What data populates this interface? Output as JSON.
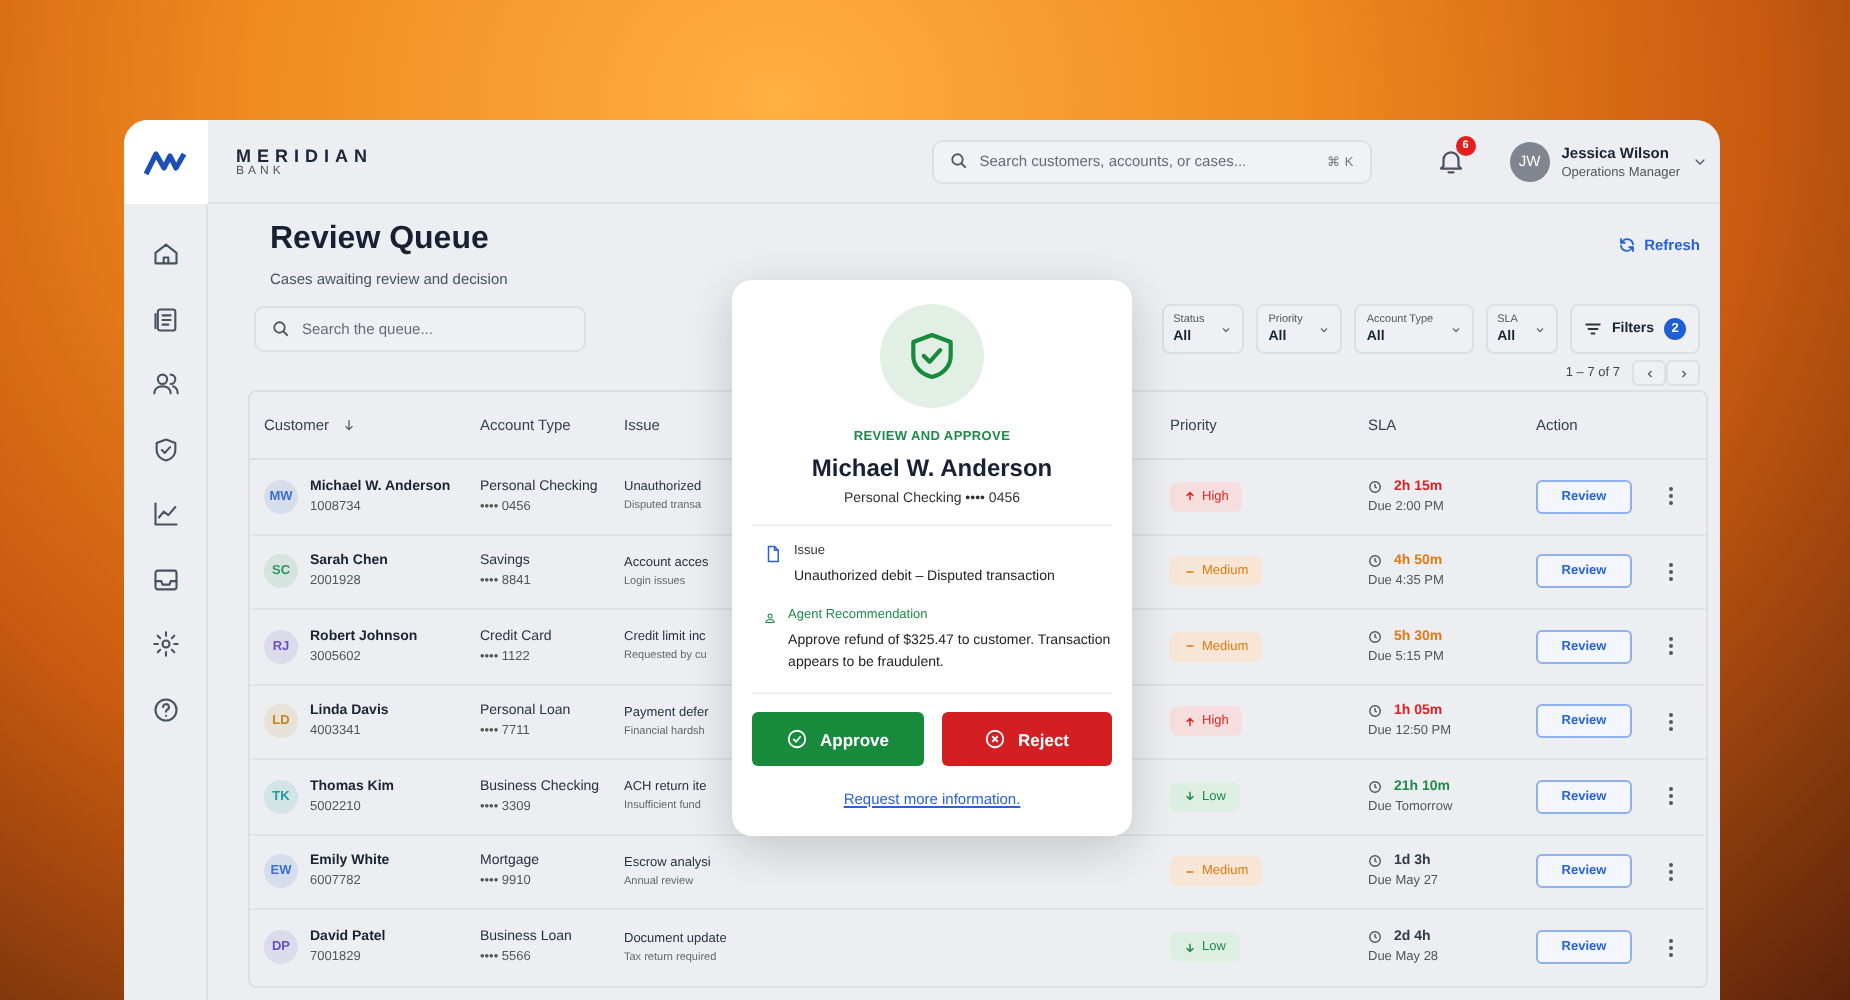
{
  "brand": {
    "name": "MERIDIAN",
    "sub": "BANK"
  },
  "search": {
    "placeholder": "Search customers, accounts, or cases...",
    "shortcut": "⌘ K"
  },
  "notifications": {
    "count": "6"
  },
  "user": {
    "initials": "JW",
    "name": "Jessica Wilson",
    "role": "Operations Manager"
  },
  "page": {
    "title": "Review Queue",
    "subtitle": "Cases awaiting review and decision",
    "refresh": "Refresh"
  },
  "queue_search": {
    "placeholder": "Search the queue..."
  },
  "filters": [
    {
      "label": "Status",
      "value": "All"
    },
    {
      "label": "Priority",
      "value": "All"
    },
    {
      "label": "Account Type",
      "value": "All"
    },
    {
      "label": "SLA",
      "value": "All"
    }
  ],
  "filters_button": {
    "label": "Filters",
    "count": "2"
  },
  "pagination": {
    "range": "1 – 7 of 7"
  },
  "table": {
    "columns": [
      {
        "label": "Customer",
        "sorted": true
      },
      {
        "label": "Account Type",
        "sorted": false
      },
      {
        "label": "Issue",
        "sorted": false
      },
      {
        "label": "Priority",
        "sorted": false
      },
      {
        "label": "SLA",
        "sorted": false
      },
      {
        "label": "Action",
        "sorted": false
      }
    ],
    "rows": [
      {
        "initials": "MW",
        "color": "#3b6fd8",
        "name": "Michael W. Anderson",
        "id": "1008734",
        "account": "Personal Checking",
        "account_number": "•••• 0456",
        "issue": "Unauthorized",
        "issue_detail": "Disputed transa",
        "priority": {
          "kind": "high",
          "label": "High"
        },
        "sla": {
          "kind": "critical",
          "time": "2h 15m",
          "due": "Due 2:00 PM"
        },
        "action": "Review"
      },
      {
        "initials": "SC",
        "color": "#2e9a5a",
        "name": "Sarah Chen",
        "id": "2001928",
        "account": "Savings",
        "account_number": "•••• 8841",
        "issue": "Account acces",
        "issue_detail": "Login issues",
        "priority": {
          "kind": "medium",
          "label": "Medium"
        },
        "sla": {
          "kind": "warning",
          "time": "4h 50m",
          "due": "Due 4:35 PM"
        },
        "action": "Review"
      },
      {
        "initials": "RJ",
        "color": "#6a4fc4",
        "name": "Robert Johnson",
        "id": "3005602",
        "account": "Credit Card",
        "account_number": "•••• 1122",
        "issue": "Credit limit inc",
        "issue_detail": "Requested by cu",
        "priority": {
          "kind": "medium",
          "label": "Medium"
        },
        "sla": {
          "kind": "warning",
          "time": "5h 30m",
          "due": "Due 5:15 PM"
        },
        "action": "Review"
      },
      {
        "initials": "LD",
        "color": "#c9851c",
        "name": "Linda Davis",
        "id": "4003341",
        "account": "Personal Loan",
        "account_number": "•••• 7711",
        "issue": "Payment defer",
        "issue_detail": "Financial hardsh",
        "priority": {
          "kind": "high",
          "label": "High"
        },
        "sla": {
          "kind": "critical",
          "time": "1h 05m",
          "due": "Due 12:50 PM"
        },
        "action": "Review"
      },
      {
        "initials": "TK",
        "color": "#1f9a9a",
        "name": "Thomas Kim",
        "id": "5002210",
        "account": "Business Checking",
        "account_number": "•••• 3309",
        "issue": "ACH return ite",
        "issue_detail": "Insufficient fund",
        "priority": {
          "kind": "low",
          "label": "Low"
        },
        "sla": {
          "kind": "ok",
          "time": "21h 10m",
          "due": "Due Tomorrow"
        },
        "action": "Review"
      },
      {
        "initials": "EW",
        "color": "#3b6fd8",
        "name": "Emily White",
        "id": "6007782",
        "account": "Mortgage",
        "account_number": "•••• 9910",
        "issue": "Escrow analysi",
        "issue_detail": "Annual review",
        "priority": {
          "kind": "medium",
          "label": "Medium"
        },
        "sla": {
          "kind": "normal",
          "time": "1d 3h",
          "due": "Due May 27"
        },
        "action": "Review"
      },
      {
        "initials": "DP",
        "color": "#6a4fc4",
        "name": "David Patel",
        "id": "7001829",
        "account": "Business Loan",
        "account_number": "•••• 5566",
        "issue": "Document update",
        "issue_detail": "Tax return required",
        "priority": {
          "kind": "low",
          "label": "Low"
        },
        "sla": {
          "kind": "normal",
          "time": "2d 4h",
          "due": "Due May 28"
        },
        "action": "Review"
      }
    ]
  },
  "modal": {
    "eyebrow": "REVIEW AND APPROVE",
    "name": "Michael W. Anderson",
    "account": "Personal Checking •••• 0456",
    "issue_label": "Issue",
    "issue": "Unauthorized debit – Disputed transaction",
    "recommendation_label": "Agent Recommendation",
    "recommendation": "Approve refund of $325.47 to customer. Transaction appears to be fraudulent.",
    "approve": "Approve",
    "reject": "Reject",
    "link": "Request more information."
  }
}
